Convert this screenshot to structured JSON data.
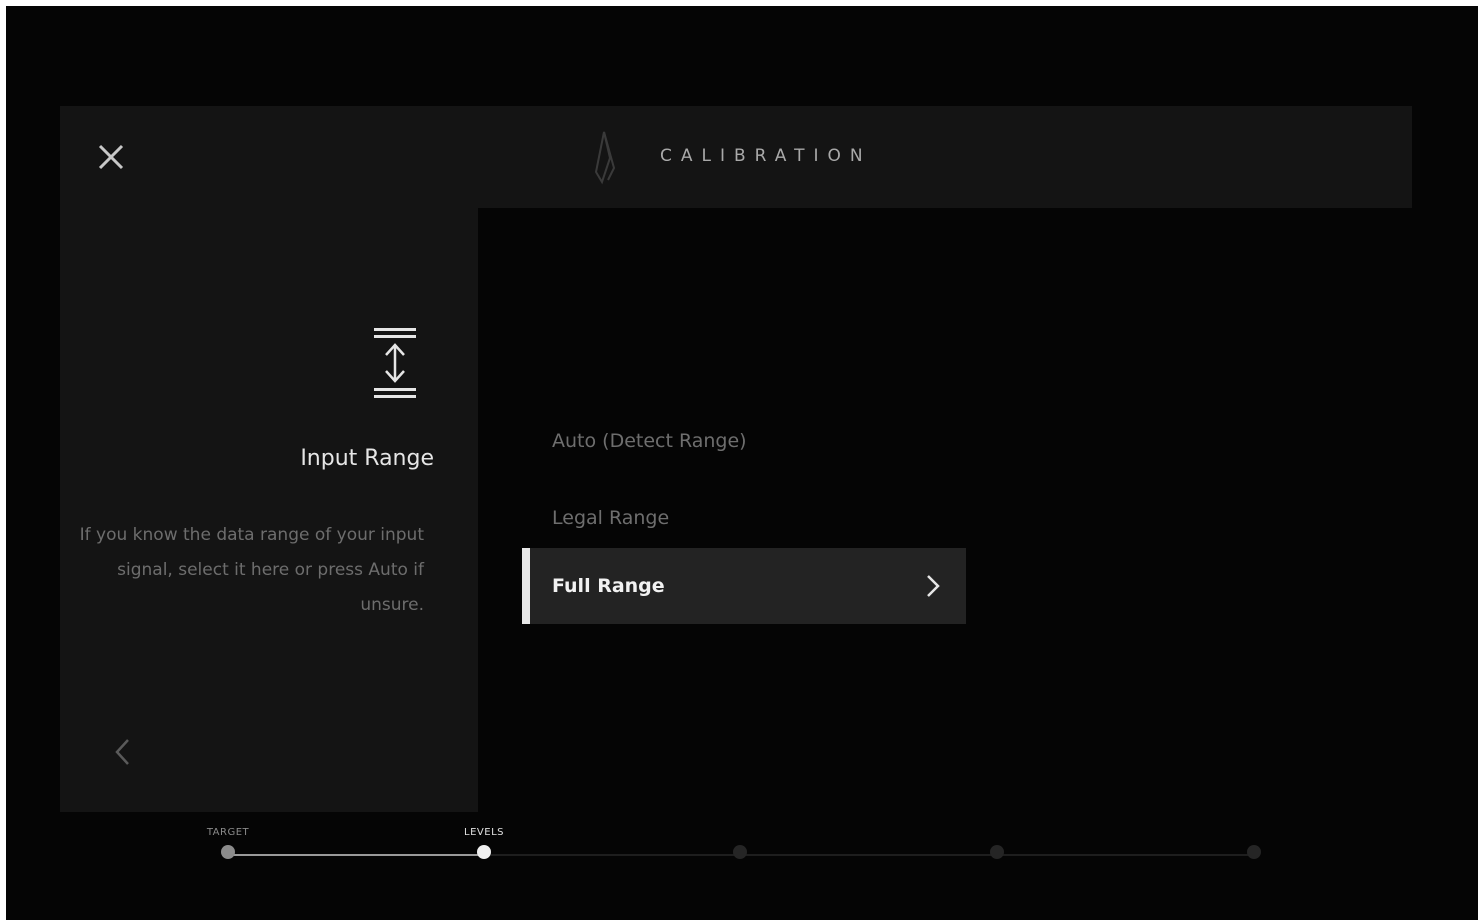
{
  "header": {
    "title": "CALIBRATION",
    "close_icon": "close-icon",
    "logo_icon": "logo-icon"
  },
  "side_panel": {
    "icon": "input-range-icon",
    "heading": "Input Range",
    "description": "If you know the data range of your input signal, select it here or press Auto if unsure.",
    "back_icon": "chevron-left-icon"
  },
  "options": [
    {
      "label": "Auto (Detect Range)",
      "selected": false
    },
    {
      "label": "Legal Range",
      "selected": false
    },
    {
      "label": "Full Range",
      "selected": true
    }
  ],
  "progress": {
    "steps": [
      {
        "label": "TARGET",
        "state": "done"
      },
      {
        "label": "LEVELS",
        "state": "current"
      },
      {
        "label": "",
        "state": "pending"
      },
      {
        "label": "",
        "state": "pending"
      },
      {
        "label": "",
        "state": "pending"
      }
    ]
  },
  "colors": {
    "background": "#050505",
    "panel": "#141414",
    "selected_row": "#232323",
    "accent": "#e8e8e8",
    "muted_text": "#6e6e6e"
  }
}
